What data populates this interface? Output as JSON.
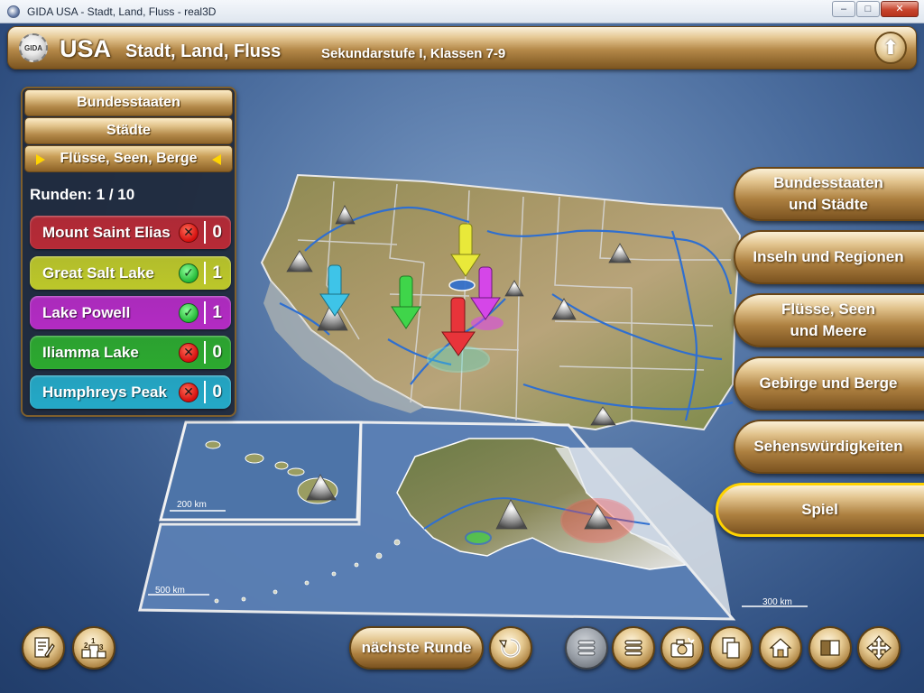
{
  "window": {
    "title": "GIDA USA - Stadt, Land, Fluss - real3D",
    "minimize": "–",
    "maximize": "□",
    "close": "✕"
  },
  "header": {
    "logo_text": "GIDA",
    "country": "USA",
    "subtitle": "Stadt, Land, Fluss",
    "grade": "Sekundarstufe I, Klassen 7-9",
    "up_symbol": "⬆"
  },
  "categories": [
    {
      "label": "Bundesstaaten",
      "active": false
    },
    {
      "label": "Städte",
      "active": false
    },
    {
      "label": "Flüsse, Seen, Berge",
      "active": true
    }
  ],
  "rounds": {
    "label": "Runden:",
    "value": "1 / 10"
  },
  "score_rows": [
    {
      "label": "Mount Saint Elias",
      "correct": false,
      "points": "0",
      "color": "#b72a36"
    },
    {
      "label": "Great Salt Lake",
      "correct": true,
      "points": "1",
      "color": "#bcc72a"
    },
    {
      "label": "Lake Powell",
      "correct": true,
      "points": "1",
      "color": "#b32bc3"
    },
    {
      "label": "Iliamma Lake",
      "correct": false,
      "points": "0",
      "color": "#2ca92f"
    },
    {
      "label": "Humphreys Peak",
      "correct": false,
      "points": "0",
      "color": "#24a9c7"
    }
  ],
  "menu": [
    {
      "label": "Bundesstaaten\nund Städte",
      "active": false
    },
    {
      "label": "Inseln und Regionen",
      "active": false
    },
    {
      "label": "Flüsse, Seen\nund Meere",
      "active": false
    },
    {
      "label": "Gebirge und Berge",
      "active": false
    },
    {
      "label": "Sehenswürdigkeiten",
      "active": false
    },
    {
      "label": "Spiel",
      "active": true
    }
  ],
  "map": {
    "scale_hawaii": "200 km",
    "scale_alaska": "500 km",
    "scale_main": "300 km"
  },
  "toolbar": {
    "next_round": "nächste Runde",
    "podium_digits": [
      "1",
      "2",
      "3"
    ]
  },
  "icons": [
    "notes-icon",
    "podium-icon",
    "restart-icon",
    "list-dim-icon",
    "list-icon",
    "camera-icon",
    "copy-icon",
    "home-icon",
    "window-icon",
    "move-icon"
  ],
  "colors": {
    "gold": "#c9a261",
    "gold_dark": "#7b5320",
    "active_frame": "#ffd200",
    "background": "#4b6d9e"
  }
}
